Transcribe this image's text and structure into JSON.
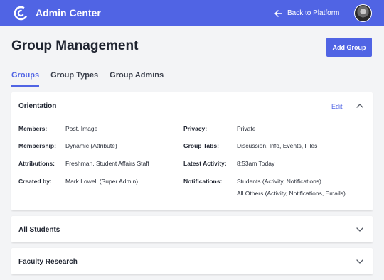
{
  "header": {
    "app_title": "Admin Center",
    "back_label": "Back to Platform",
    "brand_color": "#5064e4"
  },
  "page": {
    "title": "Group Management",
    "add_button": "Add Group"
  },
  "tabs": [
    {
      "label": "Groups",
      "active": true
    },
    {
      "label": "Group Types",
      "active": false
    },
    {
      "label": "Group Admins",
      "active": false
    }
  ],
  "groups": [
    {
      "name": "Orientation",
      "expanded": true,
      "edit_label": "Edit",
      "left_fields": [
        {
          "label": "Members:",
          "value": "Post, Image"
        },
        {
          "label": "Membership:",
          "value": "Dynamic (Attribute)"
        },
        {
          "label": "Attributions:",
          "value": "Freshman, Student Affairs Staff"
        },
        {
          "label": "Created by:",
          "value": "Mark Lowell (Super Admin)"
        }
      ],
      "right_fields": [
        {
          "label": "Privacy:",
          "value": "Private"
        },
        {
          "label": "Group Tabs:",
          "value": "Discussion, Info, Events, Files"
        },
        {
          "label": "Latest Activity:",
          "value": "8:53am Today"
        },
        {
          "label": "Notifications:",
          "value": "Students (Activity, Notifications)",
          "value2": "All Others (Activity, Notifications, Emails)"
        }
      ]
    },
    {
      "name": "All Students",
      "expanded": false
    },
    {
      "name": "Faculty Research",
      "expanded": false
    }
  ]
}
